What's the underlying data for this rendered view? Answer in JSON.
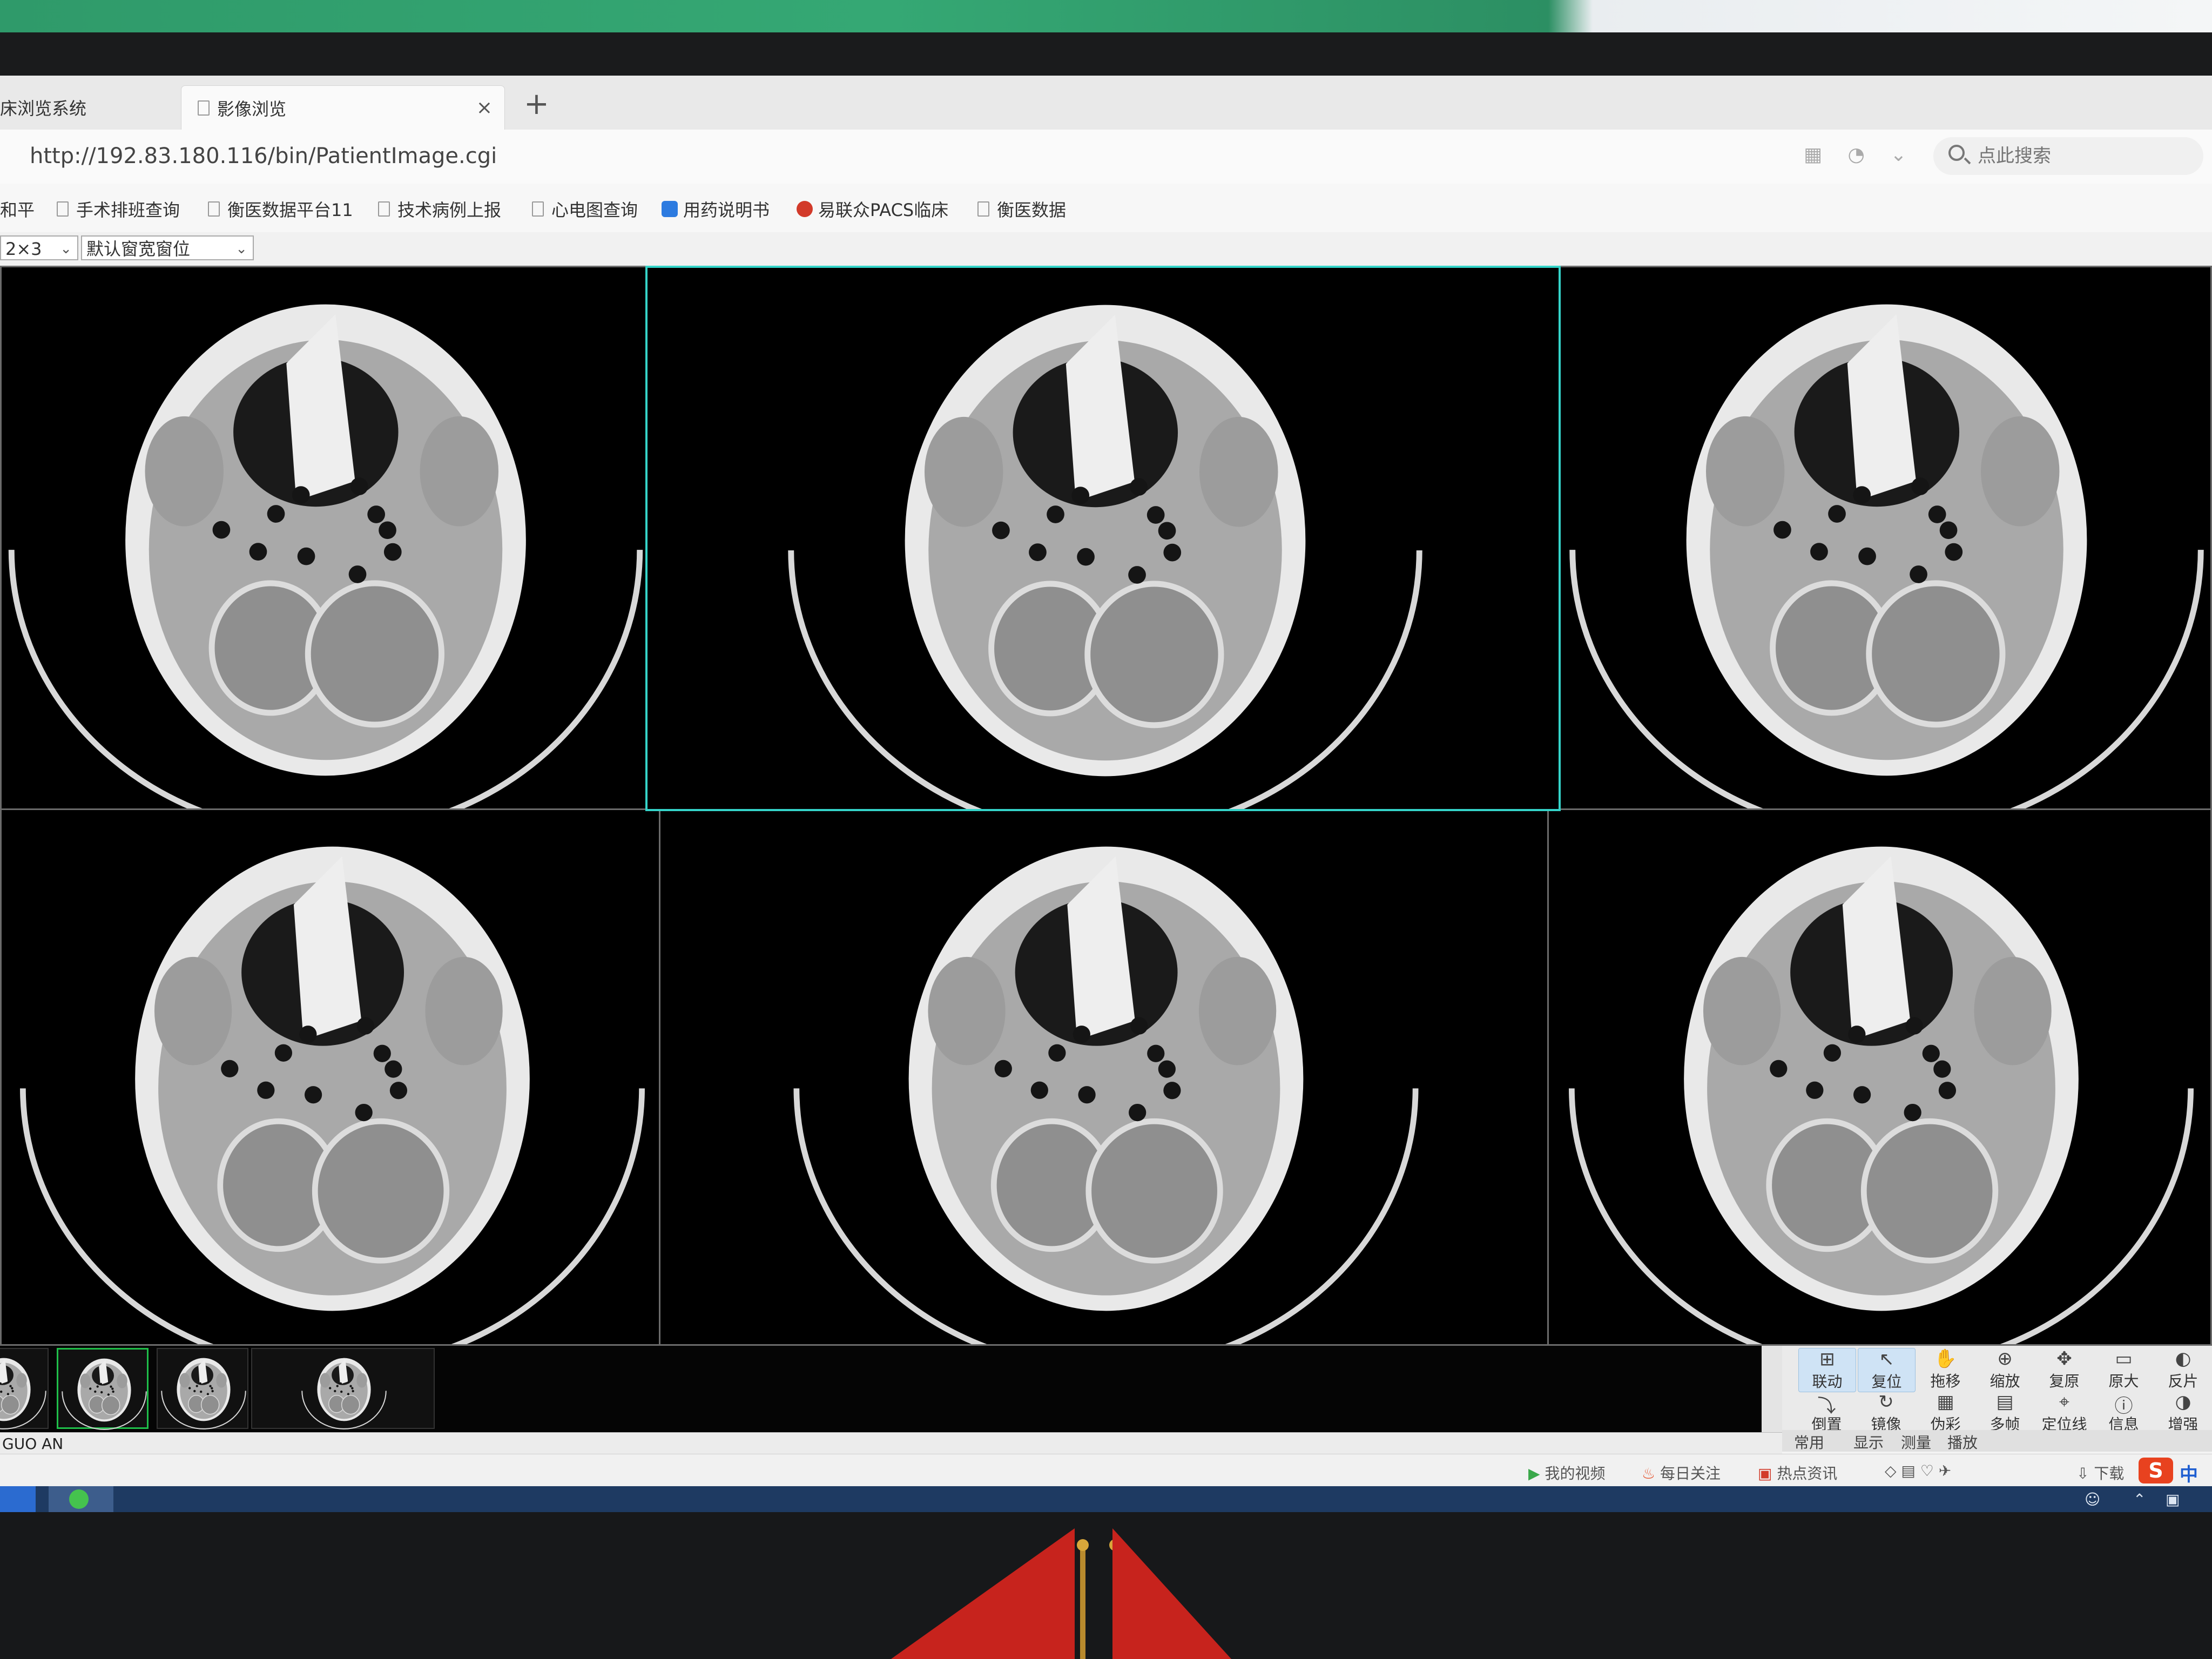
{
  "browser": {
    "tabs": [
      {
        "label": "床浏览系统"
      },
      {
        "label": "影像浏览"
      }
    ],
    "close_glyph": "×",
    "new_tab_glyph": "+",
    "url": "http://192.83.180.116/bin/PatientImage.cgi",
    "search_placeholder": "点此搜索"
  },
  "bookmarks": [
    {
      "label": "和平",
      "icon": "doc-icon"
    },
    {
      "label": "手术排班查询",
      "icon": "doc-icon"
    },
    {
      "label": "衡医数据平台11",
      "icon": "doc-icon"
    },
    {
      "label": "技术病例上报",
      "icon": "doc-icon"
    },
    {
      "label": "心电图查询",
      "icon": "doc-icon"
    },
    {
      "label": "用药说明书",
      "icon": "link-icon",
      "color": "#2d7be0"
    },
    {
      "label": "易联众PACS临床",
      "icon": "logo-icon",
      "color": "#d23a2a"
    },
    {
      "label": "衡医数据",
      "icon": "doc-icon"
    }
  ],
  "viewer": {
    "layout_select": "2×3",
    "window_select": "默认窗宽窗位",
    "active_cell_color": "#35d4c9",
    "patient_name": "GUO AN",
    "tools_row1": [
      {
        "label": "联动",
        "icon": "link-panels-icon",
        "active": true
      },
      {
        "label": "复位",
        "icon": "cursor-icon",
        "active": true
      },
      {
        "label": "拖移",
        "icon": "hand-icon"
      },
      {
        "label": "缩放",
        "icon": "zoom-icon"
      },
      {
        "label": "复原",
        "icon": "move-icon"
      },
      {
        "label": "原大",
        "icon": "original-size-icon"
      },
      {
        "label": "反片",
        "icon": "invert-icon"
      }
    ],
    "tools_row2": [
      {
        "label": "倒置",
        "icon": "flip-vertical-icon"
      },
      {
        "label": "镜像",
        "icon": "mirror-icon"
      },
      {
        "label": "伪彩",
        "icon": "pseudocolor-icon"
      },
      {
        "label": "多帧",
        "icon": "multiframe-icon"
      },
      {
        "label": "定位线",
        "icon": "locator-icon"
      },
      {
        "label": "信息",
        "icon": "info-icon"
      },
      {
        "label": "增强",
        "icon": "enhance-icon"
      }
    ],
    "tool_tabs": [
      "常用",
      "显示",
      "测量",
      "播放"
    ]
  },
  "status": {
    "items": [
      "我的视频",
      "每日关注",
      "热点资讯",
      "下载"
    ],
    "ime_logo": "S",
    "ime_mode": "中"
  }
}
